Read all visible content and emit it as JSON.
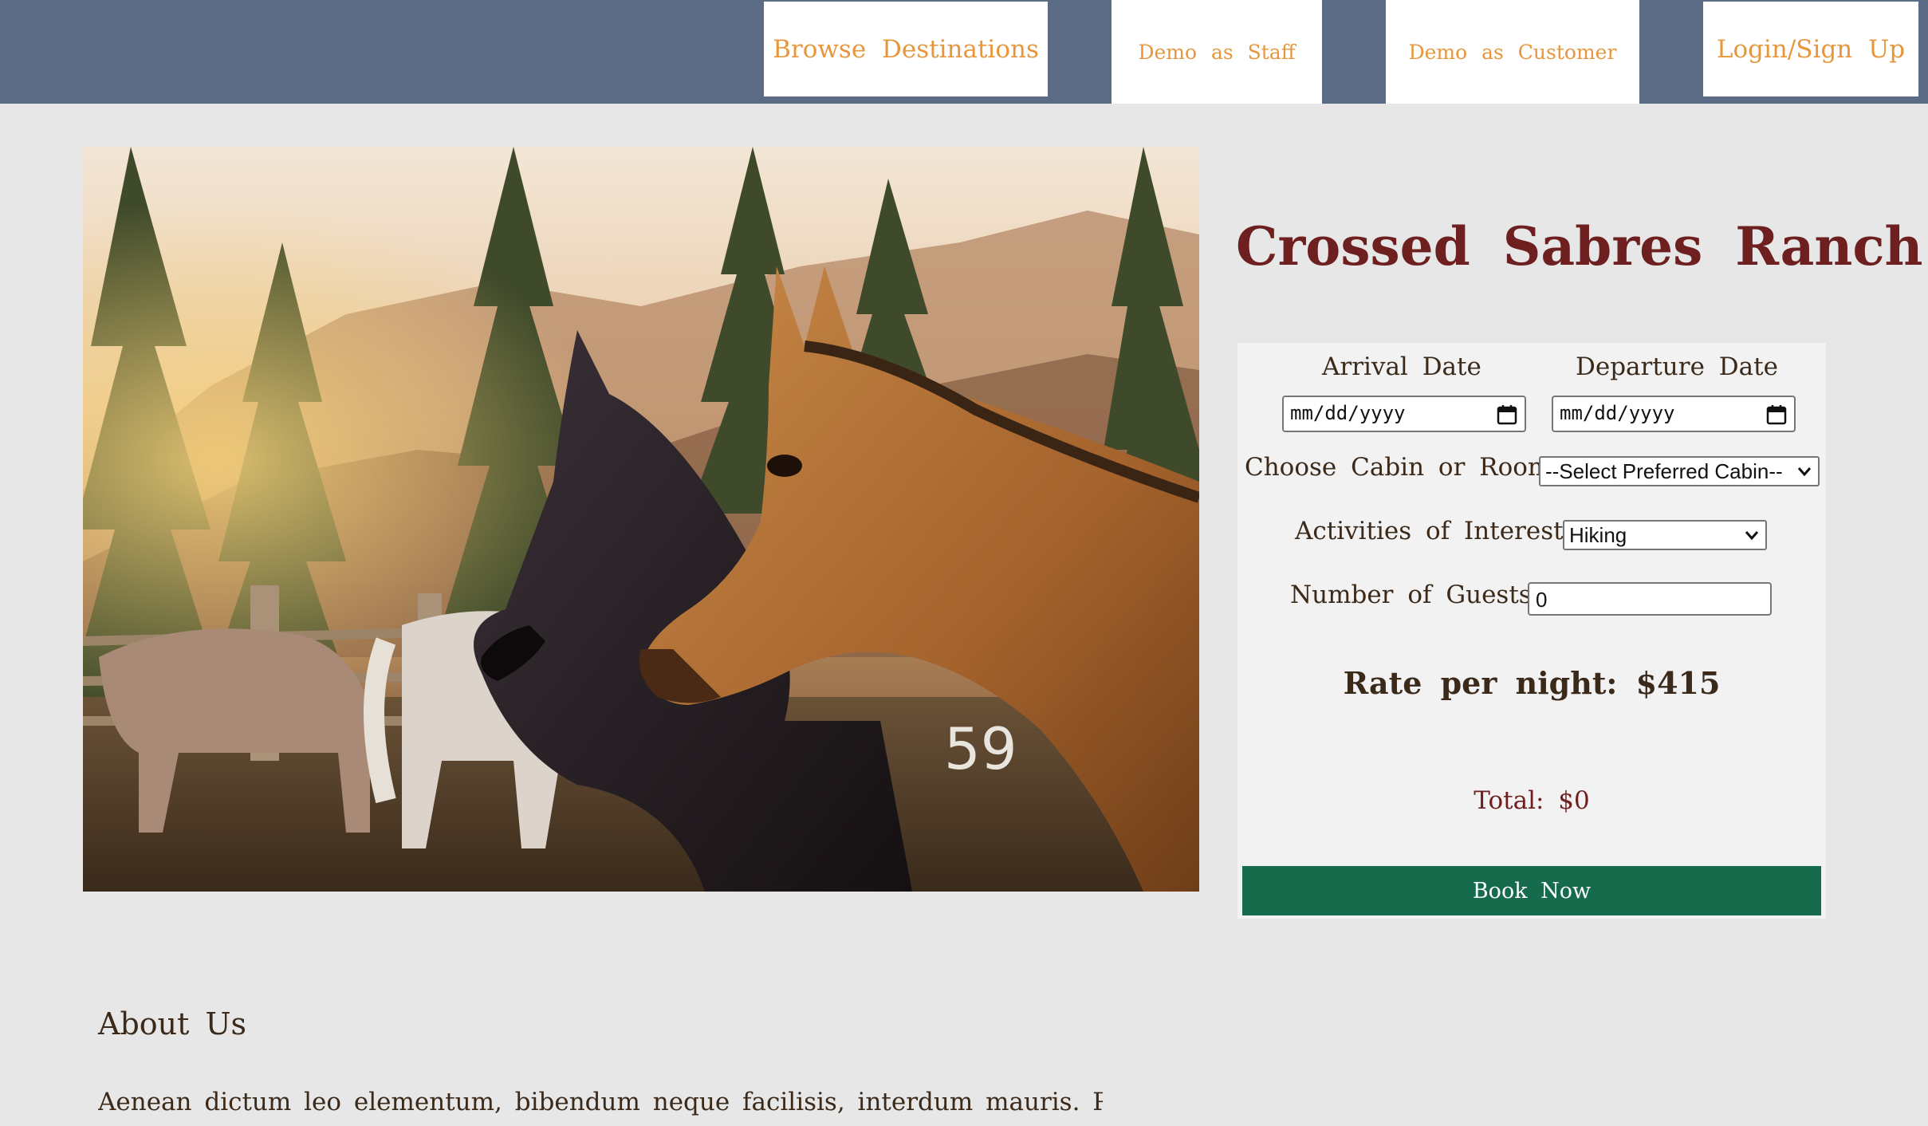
{
  "nav": {
    "browse": "Browse Destinations",
    "demo_staff": "Demo as Staff",
    "demo_customer": "Demo as Customer",
    "login": "Login/Sign Up"
  },
  "hero": {
    "image_icon": "horses-photo",
    "flank_number": "59"
  },
  "ranch": {
    "name": "Crossed Sabres Ranch"
  },
  "booking": {
    "arrival_label": "Arrival Date",
    "departure_label": "Departure Date",
    "arrival_value": "mm/dd/yyyy",
    "departure_value": "mm/dd/yyyy",
    "cabin_label": "Choose Cabin or Room:",
    "cabin_selected": "--Select Preferred Cabin--",
    "activities_label": "Activities of Interest:",
    "activity_selected": "Hiking",
    "guests_label": "Number of Guests:",
    "guests_value": "0",
    "rate_text": "Rate per night: $415",
    "total_text": "Total: $0",
    "book_label": "Book Now"
  },
  "about": {
    "title": "About Us",
    "text": "Aenean dictum leo elementum, bibendum neque facilisis, interdum mauris. Praesent"
  },
  "colors": {
    "nav_bg": "#5b6a85",
    "nav_text": "#e8963c",
    "page_bg": "#e7e7e7",
    "title": "#6e1f1f",
    "book_button": "#156b4c"
  }
}
